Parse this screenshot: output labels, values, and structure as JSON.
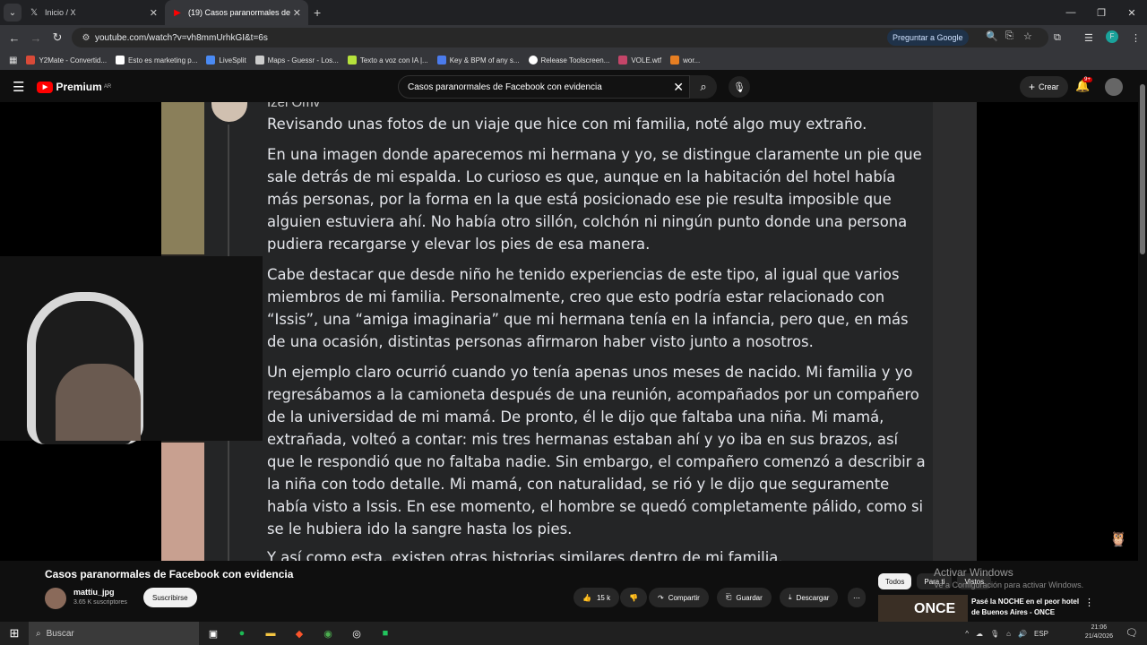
{
  "browser": {
    "tabs": [
      {
        "label": "Inicio / X"
      },
      {
        "label": "(19) Casos paranormales de"
      }
    ],
    "url": "youtube.com/watch?v=vh8mmUrhkGI&t=6s",
    "google_button": "Preguntar a Google",
    "bookmarks": [
      {
        "label": "Y2Mate - Convertid...",
        "color": "#d94a38"
      },
      {
        "label": "Esto es marketing p...",
        "color": "#ffffff"
      },
      {
        "label": "LiveSplit",
        "color": "#4a8af4"
      },
      {
        "label": "Maps - Guessr - Los...",
        "color": "#cccccc"
      },
      {
        "label": "Texto a voz con IA |...",
        "color": "#b6e23c"
      },
      {
        "label": "Key & BPM of any s...",
        "color": "#4b7bec"
      },
      {
        "label": "Release Toolscreen...",
        "color": "#ffffff"
      },
      {
        "label": "VOLE.wtf",
        "color": "#c44569"
      },
      {
        "label": "wor...",
        "color": "#e67e22"
      }
    ]
  },
  "youtube": {
    "logo": "Premium",
    "region": "AR",
    "search_query": "Casos paranormales de Facebook con evidencia",
    "create_label": "Crear",
    "notif_count": "9+"
  },
  "post": {
    "author": "Izel Omv",
    "paragraphs": [
      "Revisando unas fotos de un viaje que hice con mi familia, noté algo muy extraño.",
      "En una imagen donde aparecemos mi hermana y yo, se distingue claramente un pie que sale detrás de mi espalda. Lo curioso es que, aunque en la habitación del hotel había más personas, por la forma en la que está posicionado ese pie resulta imposible que alguien estuviera ahí. No había otro sillón, colchón ni ningún punto donde una persona pudiera recargarse y elevar los pies de esa manera.",
      "Cabe destacar que desde niño he tenido experiencias de este tipo, al igual que varios miembros de mi familia. Personalmente, creo que esto podría estar relacionado con “Issis”, una “amiga imaginaria” que mi hermana tenía en la infancia, pero que, en más de una ocasión, distintas personas afirmaron haber visto junto a nosotros.",
      "Un ejemplo claro ocurrió cuando yo tenía apenas unos meses de nacido. Mi familia y yo regresábamos a la camioneta después de una reunión, acompañados por un compañero de la universidad de mi mamá. De pronto, él le dijo que faltaba una niña. Mi mamá, extrañada, volteó a contar: mis tres hermanas estaban ahí y yo iba en sus brazos, así que le respondió que no faltaba nadie. Sin embargo, el compañero comenzó a describir a la niña con todo detalle. Mi mamá, con naturalidad, se rió y le dijo que seguramente había visto a Issis. En ese momento, el hombre se quedó completamente pálido, como si se le hubiera ido la sangre hasta los pies.",
      "Y así como esta, existen otras historias similares dentro de mi familia."
    ]
  },
  "video": {
    "title": "Casos paranormales de Facebook con evidencia",
    "channel": "mattiu_jpg",
    "subscribers": "3.65 K suscriptores",
    "subscribe": "Suscribirse",
    "likes": "15 k",
    "share": "Compartir",
    "save": "Guardar",
    "download": "Descargar"
  },
  "sidebar": {
    "chips": [
      "Todos",
      "Para ti",
      "Vistos"
    ],
    "rec_thumb": "ONCE",
    "rec_title": "Pasé la NOCHE en el peor hotel de Buenos Aires - ONCE"
  },
  "windows": {
    "activate_title": "Activar Windows",
    "activate_sub": "Ve a Configuración para activar Windows.",
    "search": "Buscar",
    "lang": "ESP",
    "time": "21:06",
    "date": "21/4/2026"
  }
}
